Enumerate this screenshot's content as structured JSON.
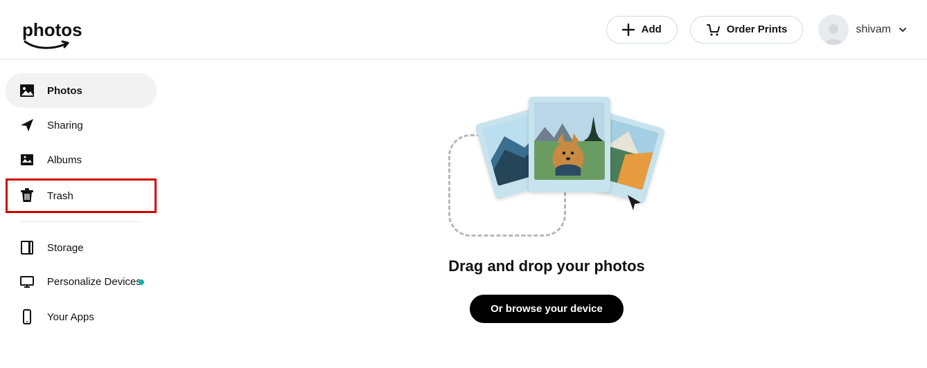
{
  "logo_text": "photos",
  "header": {
    "add_label": "Add",
    "order_prints_label": "Order Prints",
    "user_name": "shivam"
  },
  "sidebar": {
    "items": [
      {
        "label": "Photos"
      },
      {
        "label": "Sharing"
      },
      {
        "label": "Albums"
      },
      {
        "label": "Trash"
      },
      {
        "label": "Storage"
      },
      {
        "label": "Personalize Devices"
      },
      {
        "label": "Your Apps"
      }
    ]
  },
  "main": {
    "headline": "Drag and drop your photos",
    "browse_label": "Or browse your device"
  }
}
